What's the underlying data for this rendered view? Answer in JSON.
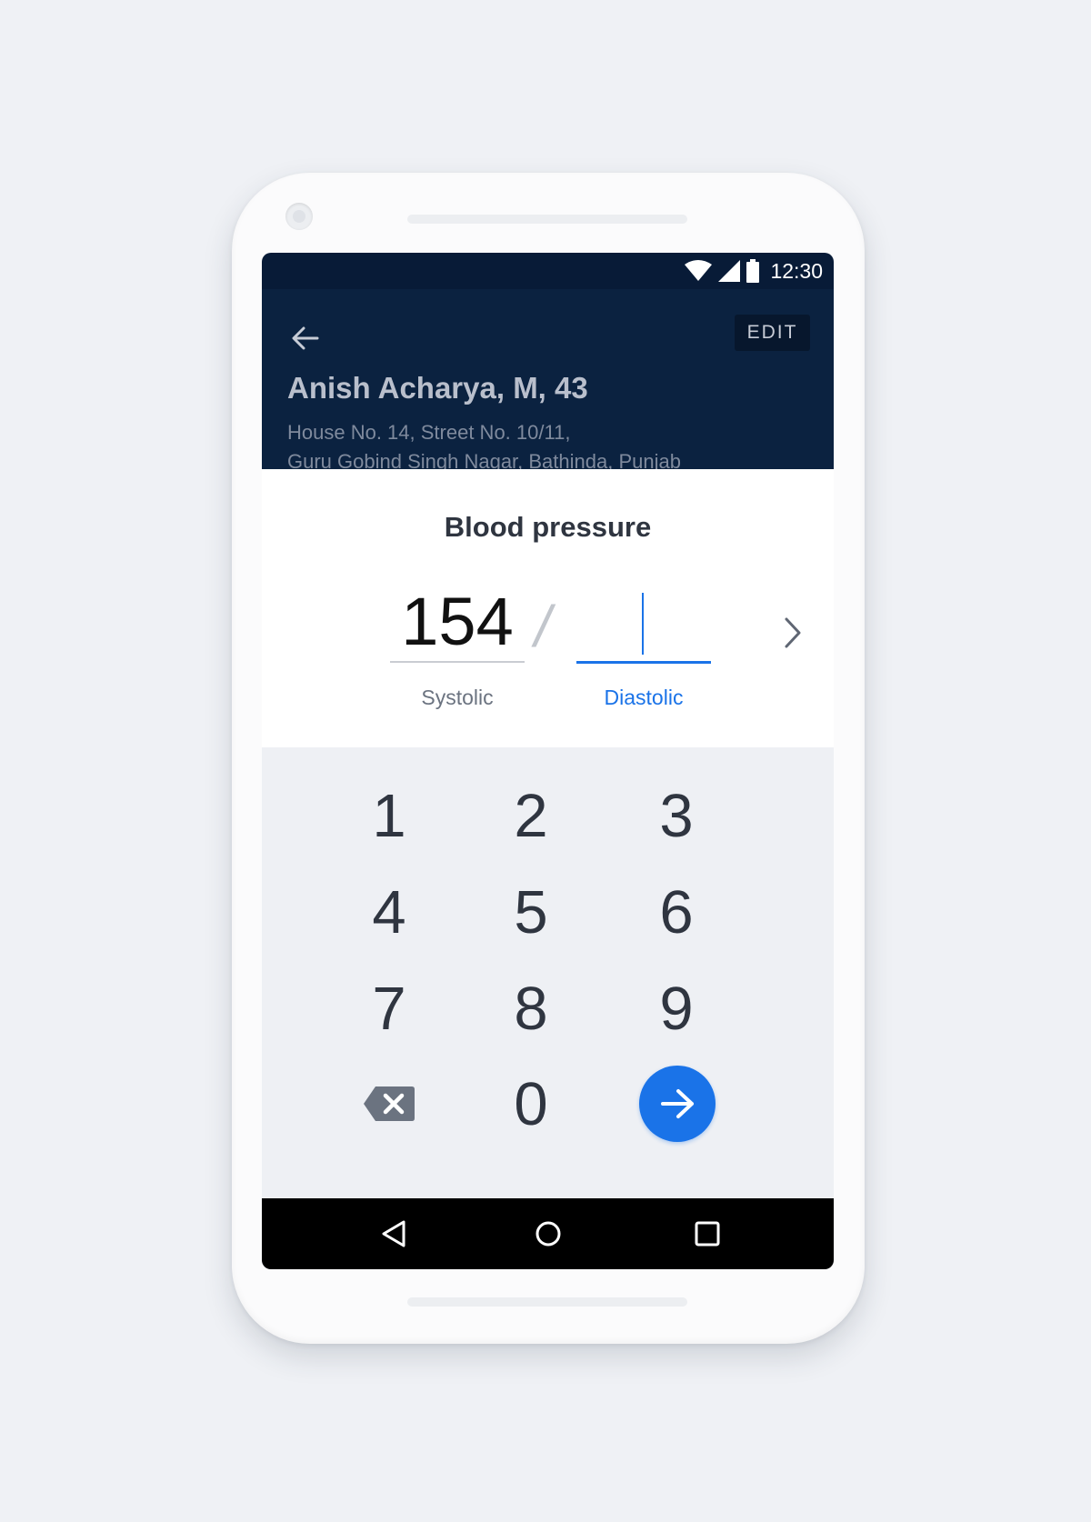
{
  "status_bar": {
    "time": "12:30",
    "icons": [
      "wifi-icon",
      "signal-icon",
      "battery-icon"
    ]
  },
  "header": {
    "back_icon": "arrow-left-icon",
    "edit_label": "EDIT",
    "patient_name": "Anish Acharya, M, 43",
    "address_line1": "House No. 14, Street No. 10/11,",
    "address_line2": "Guru Gobind Singh Nagar, Bathinda, Punjab"
  },
  "bp_card": {
    "title": "Blood pressure",
    "systolic": {
      "value": "154",
      "label": "Systolic"
    },
    "separator": "/",
    "diastolic": {
      "value": "",
      "label": "Diastolic"
    },
    "next_icon": "chevron-right-icon"
  },
  "keypad": {
    "keys": [
      "1",
      "2",
      "3",
      "4",
      "5",
      "6",
      "7",
      "8",
      "9",
      "0"
    ],
    "backspace_icon": "backspace-icon",
    "submit_icon": "arrow-right-icon"
  },
  "nav_bar": {
    "icons": [
      "back-triangle-icon",
      "home-circle-icon",
      "recents-square-icon"
    ]
  },
  "colors": {
    "header_bg": "#0b2240",
    "status_bg": "#081b37",
    "accent": "#1a73e8",
    "keypad_bg": "#eef0f4",
    "page_bg": "#eff1f5"
  }
}
